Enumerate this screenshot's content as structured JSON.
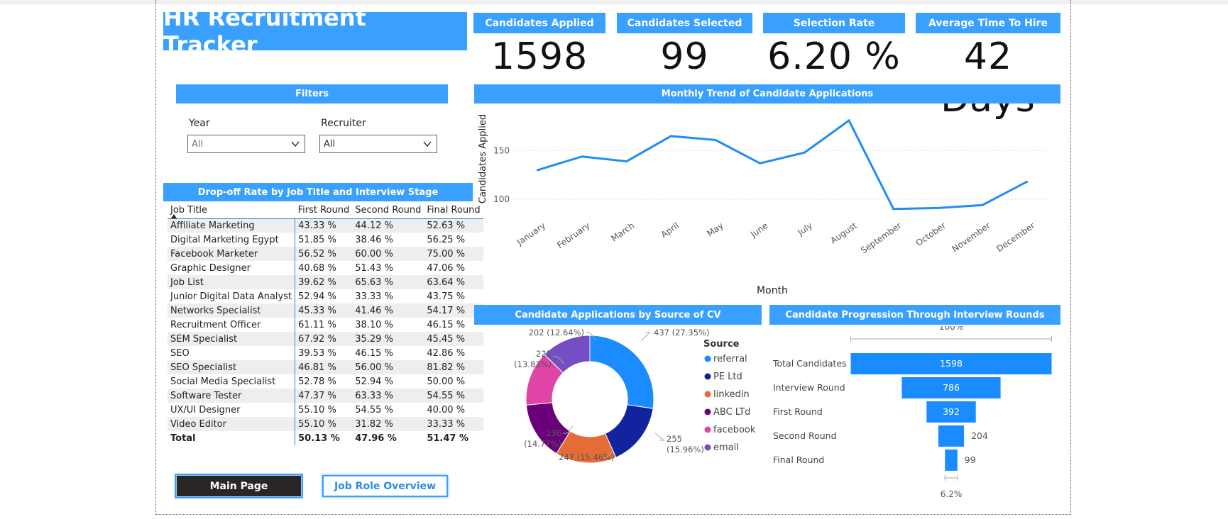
{
  "app": {
    "title": "HR Recruitment Tracker"
  },
  "kpis": [
    {
      "label": "Candidates Applied",
      "value": "1598"
    },
    {
      "label": "Candidates Selected",
      "value": "99"
    },
    {
      "label": "Selection Rate",
      "value": "6.20 %"
    },
    {
      "label": "Average Time To Hire",
      "value": "42 Days"
    }
  ],
  "filters": {
    "title": "Filters",
    "year": {
      "label": "Year",
      "value": "All"
    },
    "recruiter": {
      "label": "Recruiter",
      "value": "All"
    }
  },
  "dropoff": {
    "title": "Drop-off Rate by Job Title and Interview Stage",
    "columns": [
      "Job Title",
      "First Round",
      "Second Round",
      "Final Round"
    ],
    "rows": [
      [
        "Affiliate Marketing",
        "43.33 %",
        "44.12 %",
        "52.63 %"
      ],
      [
        "Digital Marketing Egypt",
        "51.85 %",
        "38.46 %",
        "56.25 %"
      ],
      [
        "Facebook Marketer",
        "56.52 %",
        "60.00 %",
        "75.00 %"
      ],
      [
        "Graphic Designer",
        "40.68 %",
        "51.43 %",
        "47.06 %"
      ],
      [
        "Job List",
        "39.62 %",
        "65.63 %",
        "63.64 %"
      ],
      [
        "Junior Digital Data Analyst",
        "52.94 %",
        "33.33 %",
        "43.75 %"
      ],
      [
        "Networks Specialist",
        "45.33 %",
        "41.46 %",
        "54.17 %"
      ],
      [
        "Recruitment Officer",
        "61.11 %",
        "38.10 %",
        "46.15 %"
      ],
      [
        "SEM Specialist",
        "67.92 %",
        "35.29 %",
        "45.45 %"
      ],
      [
        "SEO",
        "39.53 %",
        "46.15 %",
        "42.86 %"
      ],
      [
        "SEO Specialist",
        "46.81 %",
        "56.00 %",
        "81.82 %"
      ],
      [
        "Social Media Specialist",
        "52.78 %",
        "52.94 %",
        "50.00 %"
      ],
      [
        "Software Tester",
        "47.37 %",
        "63.33 %",
        "54.55 %"
      ],
      [
        "UX/UI Designer",
        "55.10 %",
        "54.55 %",
        "40.00 %"
      ],
      [
        "Video Editor",
        "55.10 %",
        "31.82 %",
        "33.33 %"
      ]
    ],
    "total": [
      "Total",
      "50.13 %",
      "47.96 %",
      "51.47 %"
    ]
  },
  "buttons": {
    "main": "Main Page",
    "job": "Job Role Overview"
  },
  "chart_data": [
    {
      "type": "line",
      "title": "Monthly Trend of Candidate Applications",
      "xlabel": "Month",
      "ylabel": "Candidates Applied",
      "ylim": [
        100,
        200
      ],
      "yticks": [
        "100",
        "150",
        "200"
      ],
      "grid": true,
      "categories": [
        "January",
        "February",
        "March",
        "April",
        "May",
        "June",
        "July",
        "August",
        "September",
        "October",
        "November",
        "December"
      ],
      "values": [
        130,
        144,
        139,
        165,
        161,
        137,
        148,
        181,
        90,
        91,
        94,
        118
      ],
      "color": "#1f8ef1"
    },
    {
      "type": "pie",
      "title": "Candidate Applications by Source of CV",
      "legend_title": "Source",
      "legend_position": "right",
      "slices": [
        {
          "name": "referral",
          "value": 437,
          "label1": "437 (27.35%)",
          "color": "#1a8cff"
        },
        {
          "name": "PE Ltd",
          "value": 255,
          "label1": "255",
          "label2": "(15.96%)",
          "color": "#12239e"
        },
        {
          "name": "linkedin",
          "value": 247,
          "label1": "247 (15.46%)",
          "color": "#e66c37"
        },
        {
          "name": "ABC LTd",
          "value": 236,
          "label1": "236",
          "label2": "(14.77%)",
          "color": "#6b007b"
        },
        {
          "name": "facebook",
          "value": 221,
          "label1": "221",
          "label2": "(13.83%)",
          "color": "#e044a7"
        },
        {
          "name": "email",
          "value": 202,
          "label1": "202 (12.64%)",
          "color": "#744ec2"
        }
      ]
    },
    {
      "type": "bar",
      "title": "Candidate Progression Through Interview Rounds",
      "top_label": "100%",
      "bottom_label": "6.2%",
      "categories": [
        "Total Candidates",
        "Interview Round",
        "First Round",
        "Second Round",
        "Final Round"
      ],
      "values": [
        1598,
        786,
        392,
        204,
        99
      ],
      "color": "#1a8cff"
    }
  ]
}
